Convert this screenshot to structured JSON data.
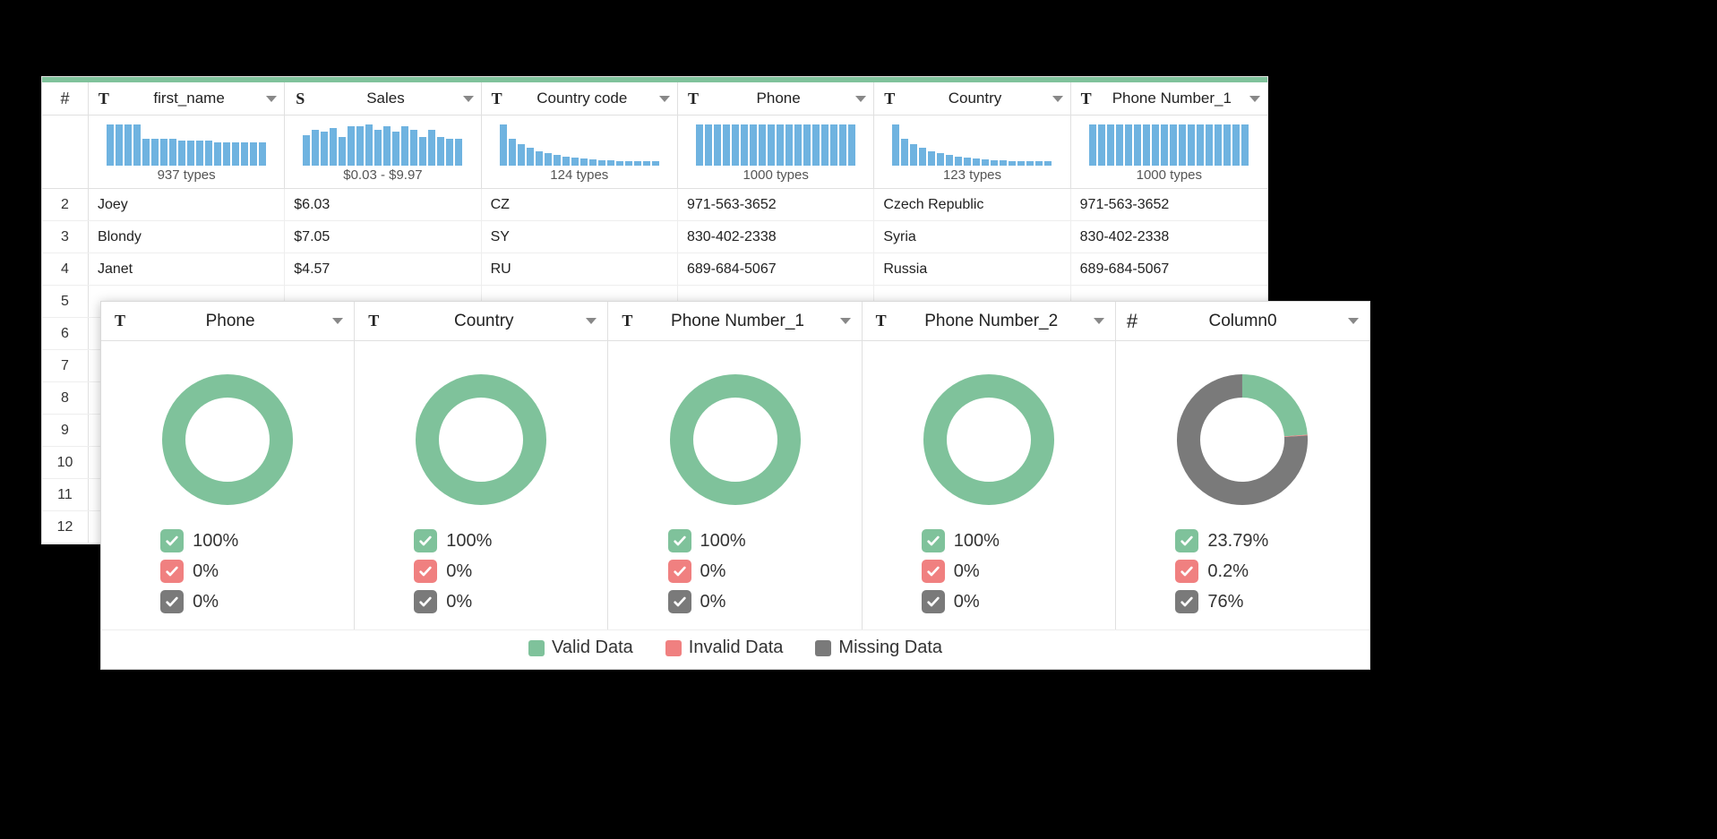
{
  "colors": {
    "valid": "#7fc29b",
    "invalid": "#f08080",
    "missing": "#7a7a7a",
    "spark": "#6fb3e0"
  },
  "table": {
    "row_num_header": "#",
    "columns": [
      {
        "type_icon": "T",
        "name": "first_name",
        "summary": "937 types",
        "spark_shape": "flat-dec"
      },
      {
        "type_icon": "S",
        "name": "Sales",
        "summary": "$0.03 - $9.97",
        "spark_shape": "uneven"
      },
      {
        "type_icon": "T",
        "name": "Country code",
        "summary": "124 types",
        "spark_shape": "tail"
      },
      {
        "type_icon": "T",
        "name": "Phone",
        "summary": "1000 types",
        "spark_shape": "flat"
      },
      {
        "type_icon": "T",
        "name": "Country",
        "summary": "123 types",
        "spark_shape": "tail"
      },
      {
        "type_icon": "T",
        "name": "Phone Number_1",
        "summary": "1000 types",
        "spark_shape": "flat"
      }
    ],
    "rows": [
      {
        "num": "2",
        "cells": [
          "Joey",
          "$6.03",
          "CZ",
          "971-563-3652",
          "Czech Republic",
          "971-563-3652"
        ]
      },
      {
        "num": "3",
        "cells": [
          "Blondy",
          "$7.05",
          "SY",
          "830-402-2338",
          "Syria",
          "830-402-2338"
        ]
      },
      {
        "num": "4",
        "cells": [
          "Janet",
          "$4.57",
          "RU",
          "689-684-5067",
          "Russia",
          "689-684-5067"
        ]
      },
      {
        "num": "5",
        "cells": [
          "",
          "",
          "",
          "",
          "",
          ""
        ]
      },
      {
        "num": "6",
        "cells": [
          "",
          "",
          "",
          "",
          "",
          ""
        ]
      },
      {
        "num": "7",
        "cells": [
          "",
          "",
          "",
          "",
          "",
          ""
        ]
      },
      {
        "num": "8",
        "cells": [
          "",
          "",
          "",
          "",
          "",
          ""
        ]
      },
      {
        "num": "9",
        "cells": [
          "",
          "",
          "",
          "",
          "",
          ""
        ]
      },
      {
        "num": "10",
        "cells": [
          "",
          "",
          "",
          "",
          "",
          ""
        ]
      },
      {
        "num": "11",
        "cells": [
          "",
          "",
          "",
          "",
          "",
          ""
        ]
      },
      {
        "num": "12",
        "cells": [
          "",
          "",
          "",
          "",
          "",
          ""
        ]
      }
    ]
  },
  "quality": {
    "columns": [
      {
        "type_icon": "T",
        "name": "Phone",
        "valid": "100%",
        "invalid": "0%",
        "missing": "0%",
        "valid_pct": 100,
        "invalid_pct": 0,
        "missing_pct": 0
      },
      {
        "type_icon": "T",
        "name": "Country",
        "valid": "100%",
        "invalid": "0%",
        "missing": "0%",
        "valid_pct": 100,
        "invalid_pct": 0,
        "missing_pct": 0
      },
      {
        "type_icon": "T",
        "name": "Phone Number_1",
        "valid": "100%",
        "invalid": "0%",
        "missing": "0%",
        "valid_pct": 100,
        "invalid_pct": 0,
        "missing_pct": 0
      },
      {
        "type_icon": "T",
        "name": "Phone Number_2",
        "valid": "100%",
        "invalid": "0%",
        "missing": "0%",
        "valid_pct": 100,
        "invalid_pct": 0,
        "missing_pct": 0
      },
      {
        "type_icon": "#",
        "name": "Column0",
        "valid": "23.79%",
        "invalid": "0.2%",
        "missing": "76%",
        "valid_pct": 23.79,
        "invalid_pct": 0.2,
        "missing_pct": 76
      }
    ],
    "legend": {
      "valid": "Valid Data",
      "invalid": "Invalid Data",
      "missing": "Missing Data"
    }
  },
  "chart_data": [
    {
      "type": "pie",
      "title": "Phone",
      "series": [
        {
          "name": "Valid",
          "value": 100
        },
        {
          "name": "Invalid",
          "value": 0
        },
        {
          "name": "Missing",
          "value": 0
        }
      ]
    },
    {
      "type": "pie",
      "title": "Country",
      "series": [
        {
          "name": "Valid",
          "value": 100
        },
        {
          "name": "Invalid",
          "value": 0
        },
        {
          "name": "Missing",
          "value": 0
        }
      ]
    },
    {
      "type": "pie",
      "title": "Phone Number_1",
      "series": [
        {
          "name": "Valid",
          "value": 100
        },
        {
          "name": "Invalid",
          "value": 0
        },
        {
          "name": "Missing",
          "value": 0
        }
      ]
    },
    {
      "type": "pie",
      "title": "Phone Number_2",
      "series": [
        {
          "name": "Valid",
          "value": 100
        },
        {
          "name": "Invalid",
          "value": 0
        },
        {
          "name": "Missing",
          "value": 0
        }
      ]
    },
    {
      "type": "pie",
      "title": "Column0",
      "series": [
        {
          "name": "Valid",
          "value": 23.79
        },
        {
          "name": "Invalid",
          "value": 0.2
        },
        {
          "name": "Missing",
          "value": 76
        }
      ]
    }
  ]
}
